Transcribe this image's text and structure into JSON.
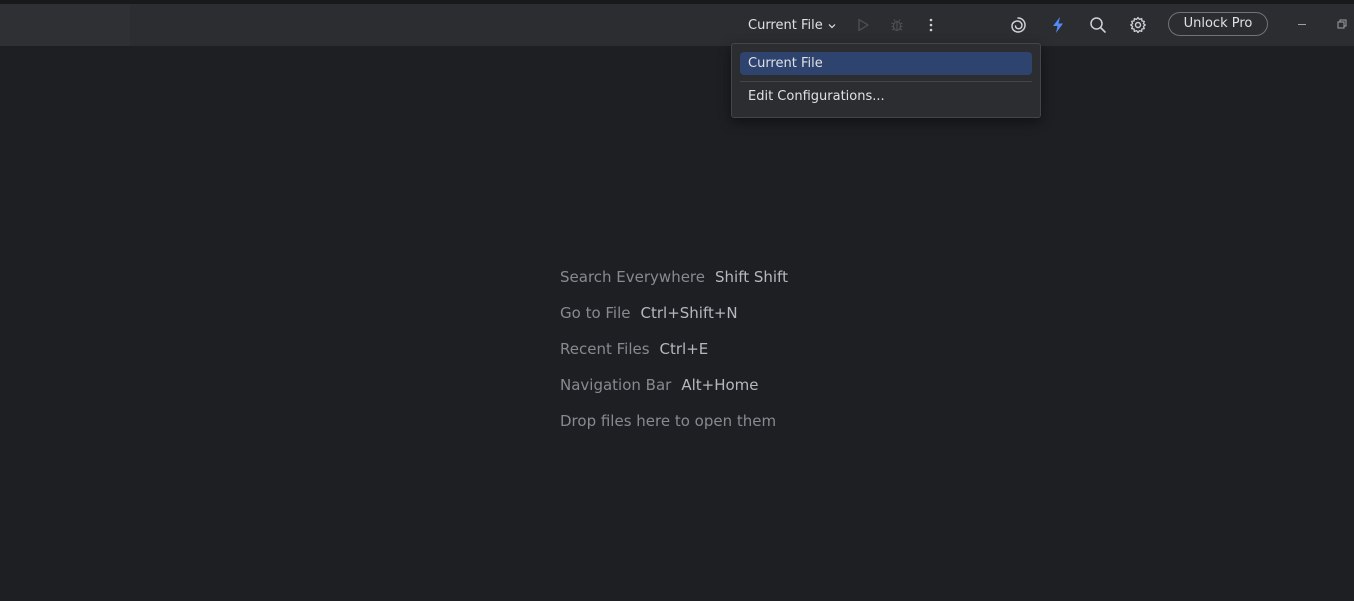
{
  "toolbar": {
    "run_config_label": "Current File",
    "unlock_label": "Unlock Pro",
    "icons": [
      "run-icon",
      "debug-icon",
      "more-vert-icon",
      "ai-assistant-icon",
      "lightning-icon",
      "search-icon",
      "gear-icon"
    ],
    "window_controls": [
      "minimize-icon",
      "restore-icon"
    ]
  },
  "dropdown": {
    "items": [
      {
        "label": "Current File",
        "selected": true
      },
      {
        "label": "Edit Configurations..."
      }
    ]
  },
  "empty_state": {
    "hints": [
      {
        "label": "Search Everywhere",
        "shortcut": "Shift Shift"
      },
      {
        "label": "Go to File",
        "shortcut": "Ctrl+Shift+N"
      },
      {
        "label": "Recent Files",
        "shortcut": "Ctrl+E"
      },
      {
        "label": "Navigation Bar",
        "shortcut": "Alt+Home"
      }
    ],
    "drop_text": "Drop files here to open them"
  },
  "colors": {
    "background": "#1e1f22",
    "toolbar": "#2b2d30",
    "selection": "#2e436e",
    "accent_blue": "#548af7"
  }
}
